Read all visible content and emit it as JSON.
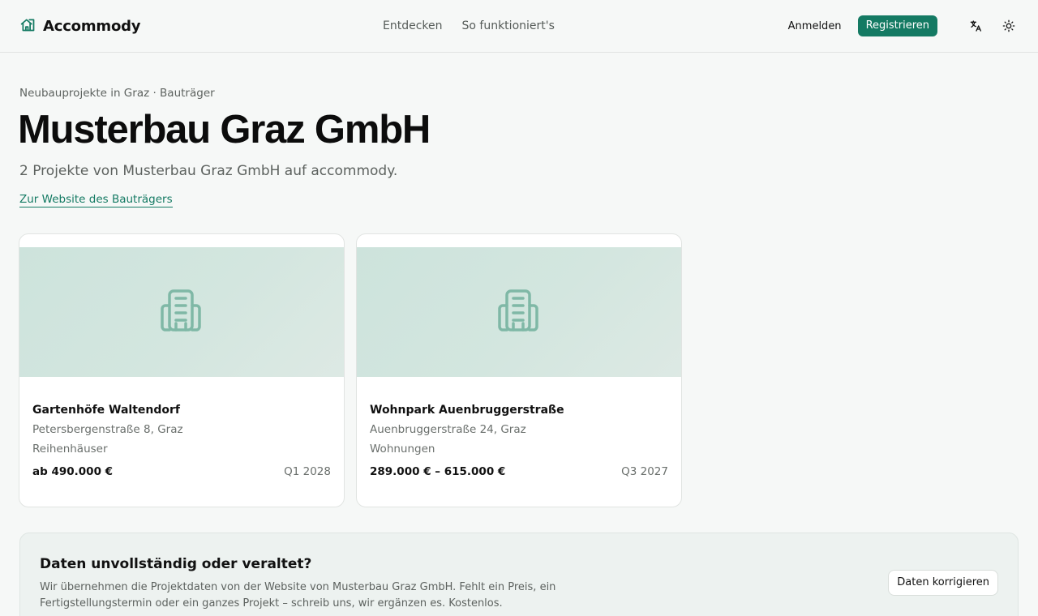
{
  "header": {
    "brand": "Accommody",
    "nav": [
      {
        "label": "Entdecken"
      },
      {
        "label": "So funktioniert's"
      }
    ],
    "login_label": "Anmelden",
    "register_label": "Registrieren",
    "icons": [
      "house-logo-icon",
      "translate-icon",
      "sun-icon"
    ]
  },
  "page": {
    "breadcrumb": "Neubauprojekte in Graz · Bauträger",
    "title": "Musterbau Graz GmbH",
    "subtitle": "2 Projekte von Musterbau Graz GmbH auf accommody.",
    "website_link": "Zur Website des Bauträgers"
  },
  "projects": [
    {
      "name": "Gartenhöfe Waltendorf",
      "address": "Petersbergenstraße 8, Graz",
      "type": "Reihenhäuser",
      "price": "ab 490.000 €",
      "completion": "Q1 2028",
      "icon": "building-icon"
    },
    {
      "name": "Wohnpark Auenbruggerstraße",
      "address": "Auenbruggerstraße 24, Graz",
      "type": "Wohnungen",
      "price": "289.000 € – 615.000 €",
      "completion": "Q3 2027",
      "icon": "building-icon"
    }
  ],
  "notice": {
    "title": "Daten unvollständig oder veraltet?",
    "text": "Wir übernehmen die Projektdaten von der Website von Musterbau Graz GmbH. Fehlt ein Preis, ein Fertigstellungstermin oder ein ganzes Projekt – schreib uns, wir ergänzen es. Kostenlos.",
    "button_label": "Daten korrigieren"
  },
  "colors": {
    "accent": "#147a63",
    "background": "#f6f8f7",
    "card_image": "#d3e6df",
    "icon": "#7fb8a6"
  }
}
